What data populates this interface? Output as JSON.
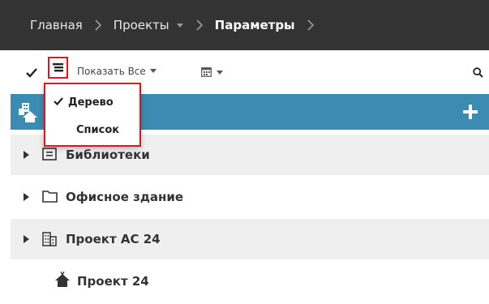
{
  "breadcrumb": {
    "items": [
      {
        "label": "Главная"
      },
      {
        "label": "Проекты"
      },
      {
        "label": "Параметры"
      }
    ]
  },
  "toolbar": {
    "show_all_label": "Показать Все",
    "icons": [
      "check-icon",
      "tree-view-icon",
      "calendar-icon",
      "search-icon"
    ]
  },
  "view_menu": {
    "items": [
      {
        "label": "Дерево",
        "checked": true
      },
      {
        "label": "Список",
        "checked": false
      }
    ]
  },
  "tree": {
    "rows": [
      {
        "label": "Библиотеки",
        "icon": "library-icon"
      },
      {
        "label": "Офисное здание",
        "icon": "folder-icon"
      },
      {
        "label": "Проект АС 24",
        "icon": "building-icon"
      },
      {
        "label": "Проект 24",
        "icon": "house-icon"
      }
    ]
  },
  "colors": {
    "header_bg": "#333334",
    "accent_bar": "#3b8bb2",
    "highlight_border": "#e0141c",
    "row_alt_bg": "#efefef"
  }
}
